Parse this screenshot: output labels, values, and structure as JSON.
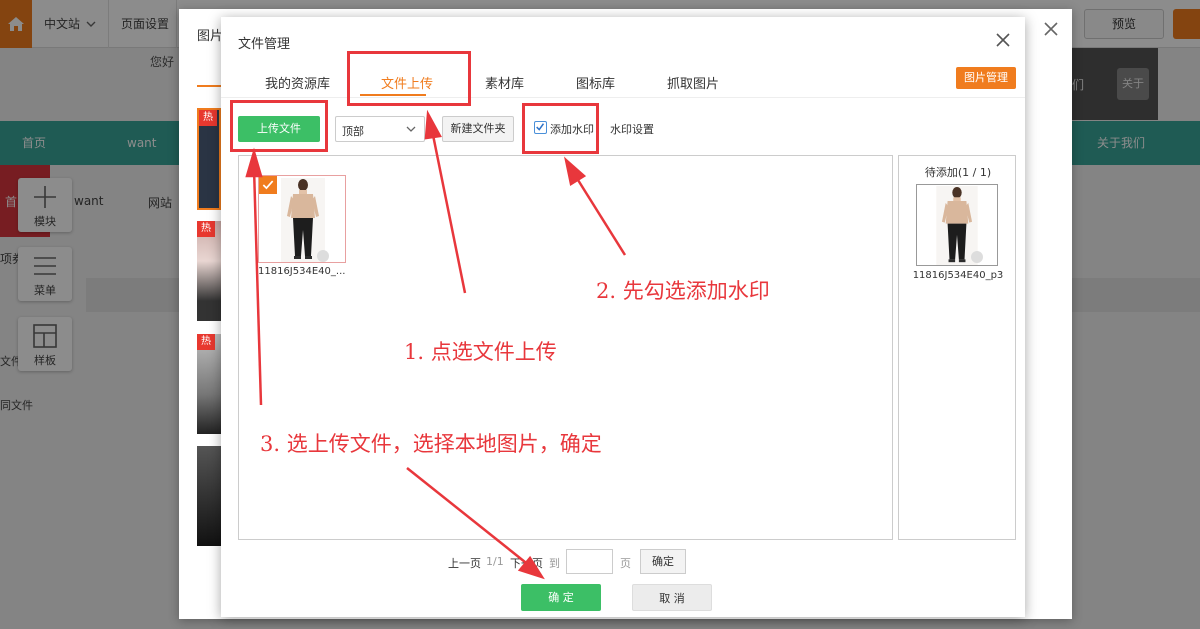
{
  "topbar": {
    "site_label": "中文站",
    "page_settings": "页面设置",
    "preview": "预览"
  },
  "site": {
    "hello": "您好",
    "banner_right_text": "关于",
    "banner_right_text2": "们",
    "nav": [
      "首页",
      "want",
      "关于我们"
    ],
    "left_red_label": "首",
    "row_labels": [
      "want",
      "网站",
      "项券",
      "文件",
      "同文件"
    ]
  },
  "tools": [
    {
      "label": "模块",
      "icon": "plus-icon"
    },
    {
      "label": "菜单",
      "icon": "menu-icon"
    },
    {
      "label": "样板",
      "icon": "template-icon"
    }
  ],
  "outer_dialog": {
    "title": "图片",
    "hot_label": "热"
  },
  "dialog": {
    "title": "文件管理",
    "tabs": [
      "我的资源库",
      "文件上传",
      "素材库",
      "图标库",
      "抓取图片"
    ],
    "active_tab": "文件上传",
    "image_manage_btn": "图片管理",
    "upload_btn": "上传文件",
    "folder": {
      "value": "顶部"
    },
    "new_folder_btn": "新建文件夹",
    "watermark": {
      "label": "添加水印",
      "checked": true
    },
    "watermark_settings": "水印设置",
    "file": {
      "name": "11816J534E40_..."
    },
    "pending": {
      "title": "待添加(1 / 1)",
      "name": "11816J534E40_p3"
    },
    "pager": {
      "prev": "上一页",
      "count": "1/1",
      "next": "下一页",
      "goto": "到",
      "page_unit": "页",
      "confirm": "确定"
    },
    "ok_btn": "确 定",
    "cancel_btn": "取 消"
  },
  "annotations": {
    "step1": "1. 点选文件上传",
    "step2": "2. 先勾选添加水印",
    "step3": "3. 选上传文件，选择本地图片，确定"
  },
  "colors": {
    "accent": "#f07c1e",
    "green": "#3cbf66",
    "nav_teal": "#3aa79a",
    "annotation_red": "#e8373c"
  }
}
